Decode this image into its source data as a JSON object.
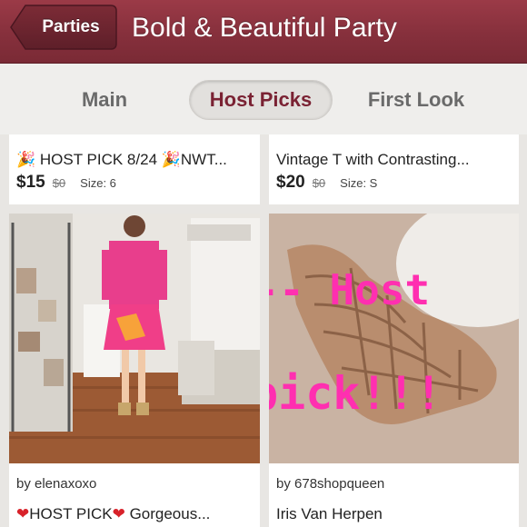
{
  "header": {
    "back_label": "Parties",
    "title": "Bold & Beautiful Party",
    "bg_color": "#86303c"
  },
  "tabs": [
    {
      "label": "Main",
      "active": false
    },
    {
      "label": "Host Picks",
      "active": true
    },
    {
      "label": "First Look",
      "active": false
    }
  ],
  "listings_top": [
    {
      "title": "🎉 HOST PICK 8/24 🎉NWT...",
      "price": "$15",
      "original_price": "$0",
      "size": "Size: 6"
    },
    {
      "title": "Vintage T with Contrasting...",
      "price": "$20",
      "original_price": "$0",
      "size": "Size: S"
    }
  ],
  "listings_bottom": [
    {
      "byline": "by elenaxoxo",
      "title": "HOST PICK",
      "title_suffix": "Gorgeous..."
    },
    {
      "byline": "by 678shopqueen",
      "title": "Iris Van Herpen",
      "overlay_line1": "<--- Host",
      "overlay_line2": "pick!!!"
    }
  ],
  "colors": {
    "accent": "#7a2233",
    "overlay_text": "#ff2fb0"
  }
}
